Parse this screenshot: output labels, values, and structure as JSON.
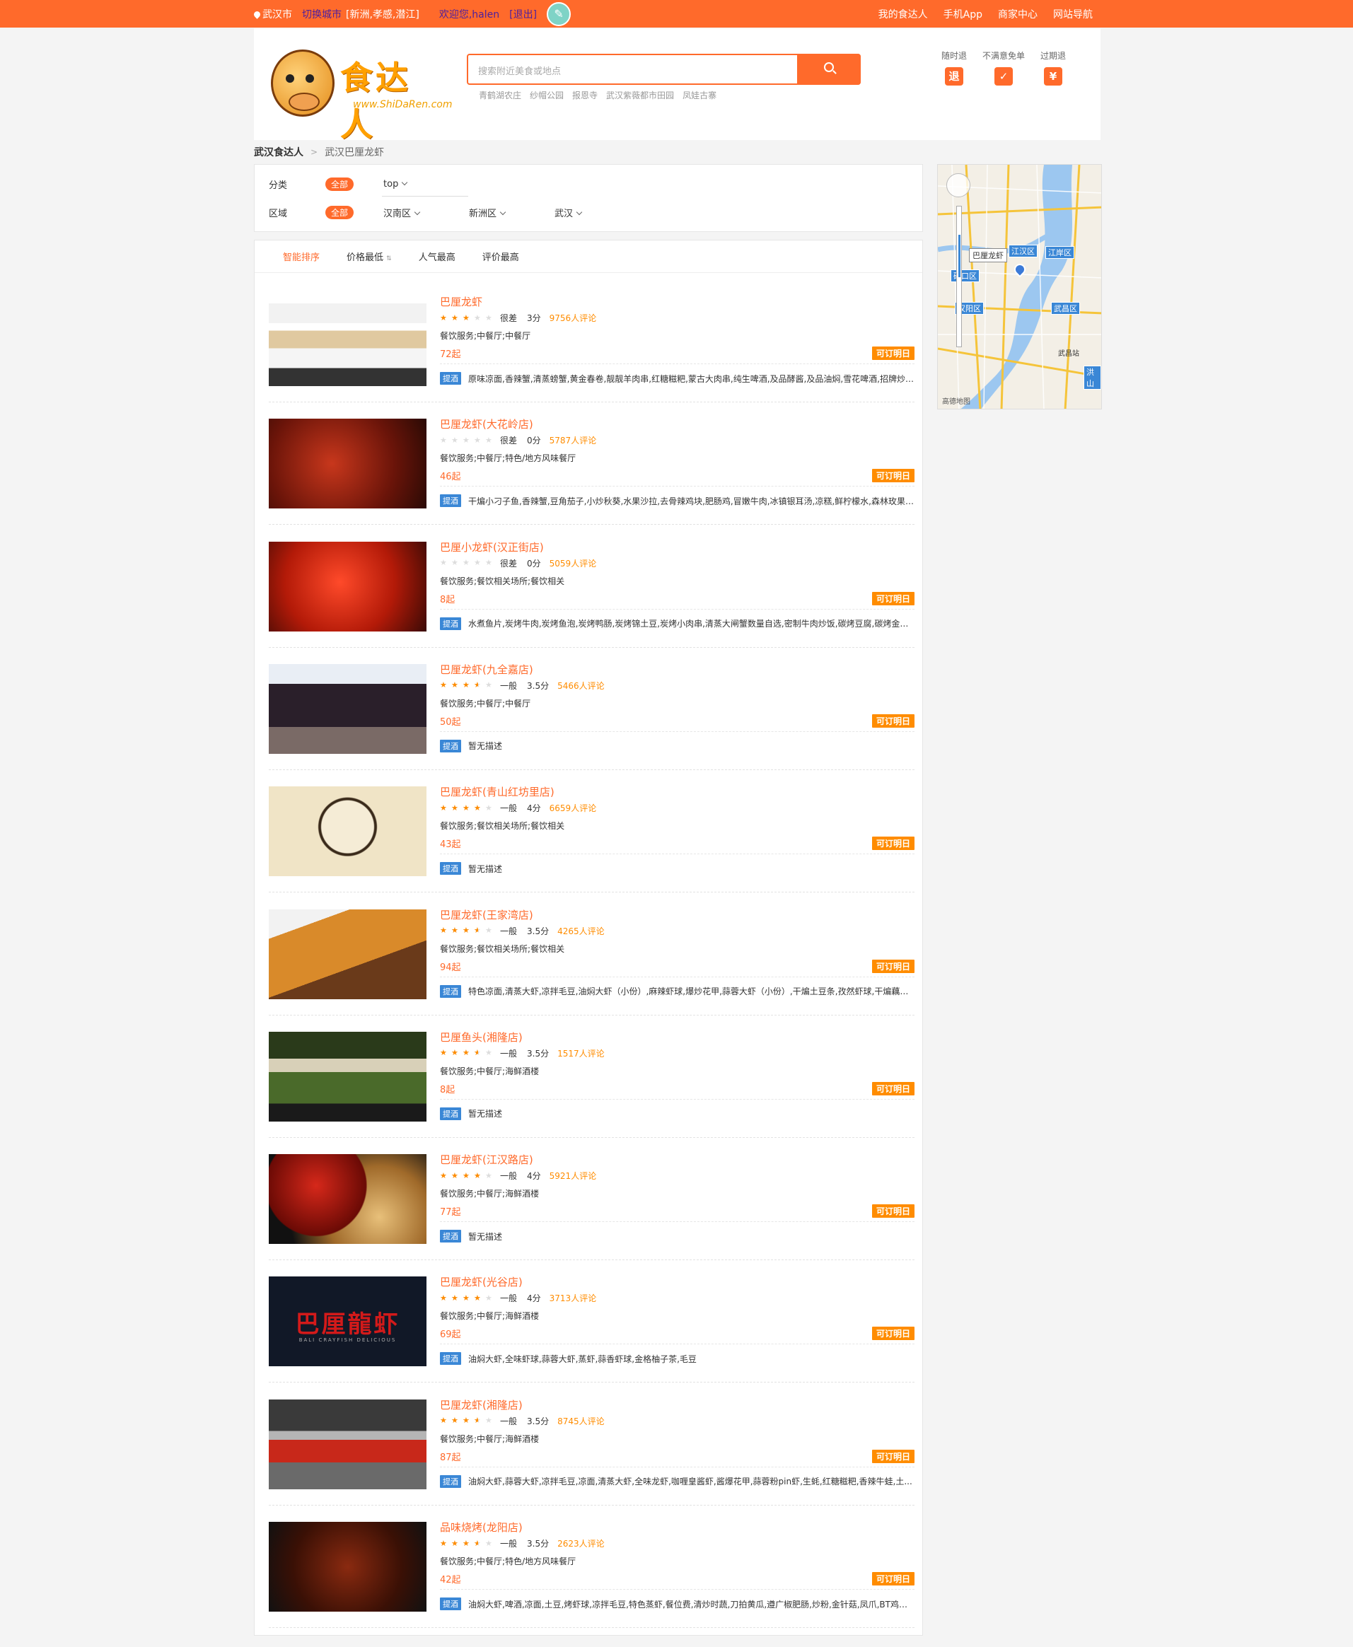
{
  "topbar": {
    "city": "武汉市",
    "switch_city": "切换城市",
    "nearby": "[新洲,孝感,潜江]",
    "welcome": "欢迎您,halen",
    "logout": "[退出]",
    "links": [
      "我的食达人",
      "手机App",
      "商家中心",
      "网站导航"
    ]
  },
  "header": {
    "logo_text": "食达人",
    "logo_url": "www.ShiDaRen.com",
    "search_placeholder": "搜索附近美食或地点",
    "hotwords": [
      "青鹤湖农庄",
      "纱帽公园",
      "报恩寺",
      "武汉紫薇都市田园",
      "凤娃古寨"
    ],
    "promises": [
      {
        "label": "随时退",
        "icon": "退"
      },
      {
        "label": "不满意免单",
        "icon": "✓"
      },
      {
        "label": "过期退",
        "icon": "¥"
      }
    ]
  },
  "breadcrumb": {
    "home": "武汉食达人",
    "current": "武汉巴厘龙虾"
  },
  "filters": {
    "category_label": "分类",
    "area_label": "区域",
    "all_label": "全部",
    "category_options": [
      "top"
    ],
    "area_options": [
      "汉南区",
      "新洲区",
      "武汉"
    ]
  },
  "sorts": [
    "智能排序",
    "价格最低",
    "人气最高",
    "评价最高"
  ],
  "book_label": "可订明日",
  "rec_tag": "提酒",
  "restaurants": [
    {
      "name": "巴厘龙虾",
      "rating": 3,
      "level": "很差",
      "score": "3分",
      "reviews": "9756人评论",
      "category": "餐饮服务;中餐厅;中餐厅",
      "price": "72起",
      "desc": "原味凉面,香辣蟹,清蒸螃蟹,黄金春卷,靓靓羊肉串,红糖糍粑,蒙古大肉串,纯生啤酒,及品酵酱,及品油焖,雪花啤酒,招牌炒饭,..."
    },
    {
      "name": "巴厘龙虾(大花岭店)",
      "rating": 0,
      "level": "很差",
      "score": "0分",
      "reviews": "5787人评论",
      "category": "餐饮服务;中餐厅;特色/地方风味餐厅",
      "price": "46起",
      "desc": "干煸小刁子鱼,香辣蟹,豆角茄子,小炒秋葵,水果沙拉,去骨辣鸡块,肥肠鸡,冒嫩牛肉,冰镇银耳汤,凉糕,鲜柠檬水,森林玫果,清..."
    },
    {
      "name": "巴厘小龙虾(汉正街店)",
      "rating": 0,
      "level": "很差",
      "score": "0分",
      "reviews": "5059人评论",
      "category": "餐饮服务;餐饮相关场所;餐饮相关",
      "price": "8起",
      "desc": "水煮鱼片,炭烤牛肉,炭烤鱼泡,炭烤鸭肠,炭烤锦土豆,炭烤小肉串,清蒸大闸蟹数量自选,密制牛肉炒饭,碳烤豆腐,碳烤金针..."
    },
    {
      "name": "巴厘龙虾(九全嘉店)",
      "rating": 3.5,
      "level": "一般",
      "score": "3.5分",
      "reviews": "5466人评论",
      "category": "餐饮服务;中餐厅;中餐厅",
      "price": "50起",
      "desc": "暂无描述"
    },
    {
      "name": "巴厘龙虾(青山红坊里店)",
      "rating": 4,
      "level": "一般",
      "score": "4分",
      "reviews": "6659人评论",
      "category": "餐饮服务;餐饮相关场所;餐饮相关",
      "price": "43起",
      "desc": "暂无描述"
    },
    {
      "name": "巴厘龙虾(王家湾店)",
      "rating": 3.5,
      "level": "一般",
      "score": "3.5分",
      "reviews": "4265人评论",
      "category": "餐饮服务;餐饮相关场所;餐饮相关",
      "price": "94起",
      "desc": "特色凉面,清蒸大虾,凉拌毛豆,油焖大虾（小份）,麻辣虾球,爆炒花甲,蒜蓉大虾（小份）,干煸土豆条,孜然虾球,干煸藕丝,..."
    },
    {
      "name": "巴厘鱼头(湘隆店)",
      "rating": 3.5,
      "level": "一般",
      "score": "3.5分",
      "reviews": "1517人评论",
      "category": "餐饮服务;中餐厅;海鲜酒楼",
      "price": "8起",
      "desc": "暂无描述"
    },
    {
      "name": "巴厘龙虾(江汉路店)",
      "rating": 4,
      "level": "一般",
      "score": "4分",
      "reviews": "5921人评论",
      "category": "餐饮服务;中餐厅;海鲜酒楼",
      "price": "77起",
      "desc": "暂无描述"
    },
    {
      "name": "巴厘龙虾(光谷店)",
      "rating": 4,
      "level": "一般",
      "score": "4分",
      "reviews": "3713人评论",
      "category": "餐饮服务;中餐厅;海鲜酒楼",
      "price": "69起",
      "desc": "油焖大虾,全味虾球,蒜蓉大虾,蒸虾,蒜香虾球,金格柚子茶,毛豆"
    },
    {
      "name": "巴厘龙虾(湘隆店)",
      "rating": 3.5,
      "level": "一般",
      "score": "3.5分",
      "reviews": "8745人评论",
      "category": "餐饮服务;中餐厅;海鲜酒楼",
      "price": "87起",
      "desc": "油焖大虾,蒜蓉大虾,凉拌毛豆,凉面,清蒸大虾,全味龙虾,咖喱皇酱虾,酱爆花甲,蒜蓉粉pin虾,生蚝,红糖糍粑,香辣牛蛙,土..."
    },
    {
      "name": "品味烧烤(龙阳店)",
      "rating": 3.5,
      "level": "一般",
      "score": "3.5分",
      "reviews": "2623人评论",
      "category": "餐饮服务;中餐厅;特色/地方风味餐厅",
      "price": "42起",
      "desc": "油焖大虾,啤酒,凉面,土豆,烤虾球,凉拌毛豆,特色蒸虾,餐位费,清炒时蔬,刀拍黄瓜,遵广椒肥肠,炒粉,金针菇,凤爪,BT鸡翅,鸭..."
    }
  ],
  "thumb_logo": {
    "title": "巴厘龍虾",
    "subtitle": "BALI CRAYFISH DELICIOUS"
  },
  "map": {
    "labels": [
      "江汉区",
      "江岸区",
      "硚口区",
      "汉阳区",
      "武昌区",
      "洪山"
    ],
    "place": "巴厘龙虾",
    "station": "武昌站",
    "credit": "高德地图"
  }
}
